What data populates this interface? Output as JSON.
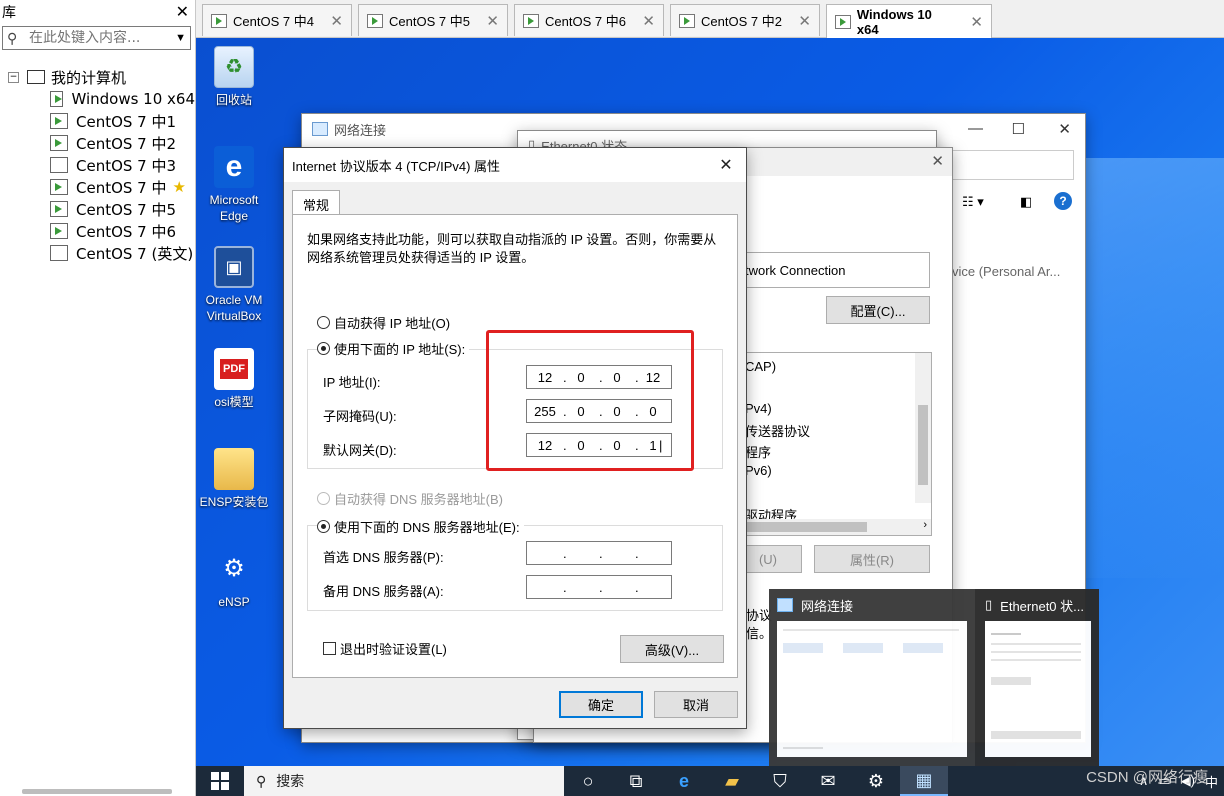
{
  "library": {
    "title": "库",
    "search_placeholder": "在此处键入内容...",
    "root": "我的计算机",
    "vms": [
      "Windows 10 x64",
      "CentOS 7 中1",
      "CentOS 7 中2",
      "CentOS 7 中3",
      "CentOS 7 中",
      "CentOS 7 中5",
      "CentOS 7 中6",
      "CentOS 7 (英文)"
    ]
  },
  "tabs": [
    "CentOS 7 中4",
    "CentOS 7 中5",
    "CentOS 7 中6",
    "CentOS 7 中2",
    "Windows 10 x64"
  ],
  "desktop_icons": [
    "回收站",
    "Microsoft Edge",
    "Oracle VM VirtualBox",
    "osi模型",
    "ENSP安装包",
    "eNSP"
  ],
  "net_window": {
    "title": "网络连接"
  },
  "eth_window": {
    "title": "Ethernet0 状态"
  },
  "props_window": {
    "adapter": "twork Connection",
    "configure_btn": "配置(C)...",
    "items": [
      "CAP)",
      "Pv4)",
      "传送器协议",
      "程序",
      "Pv6)",
      "驱动程序"
    ],
    "uninstall_btn": "(U)",
    "properties_btn": "属性(R)",
    "desc": [
      "协议",
      "信。"
    ],
    "side_text": "vice (Personal Ar..."
  },
  "ipv4": {
    "title": "Internet 协议版本 4 (TCP/IPv4) 属性",
    "tab": "常规",
    "description": "如果网络支持此功能，则可以获取自动指派的 IP 设置。否则，你需要从网络系统管理员处获得适当的 IP 设置。",
    "auto_ip": "自动获得 IP 地址(O)",
    "use_ip": "使用下面的 IP 地址(S):",
    "ip_label": "IP 地址(I):",
    "mask_label": "子网掩码(U):",
    "gw_label": "默认网关(D):",
    "ip": [
      "12",
      "0",
      "0",
      "12"
    ],
    "mask": [
      "255",
      "0",
      "0",
      "0"
    ],
    "gateway": [
      "12",
      "0",
      "0",
      "1"
    ],
    "auto_dns": "自动获得 DNS 服务器地址(B)",
    "use_dns": "使用下面的 DNS 服务器地址(E):",
    "dns1_label": "首选 DNS 服务器(P):",
    "dns2_label": "备用 DNS 服务器(A):",
    "validate": "退出时验证设置(L)",
    "advanced": "高级(V)...",
    "ok": "确定",
    "cancel": "取消"
  },
  "thumbnails": [
    "网络连接",
    "Ethernet0 状..."
  ],
  "taskbar": {
    "search": "搜索",
    "ime": "中"
  },
  "watermark": "CSDN @网络行瘦"
}
